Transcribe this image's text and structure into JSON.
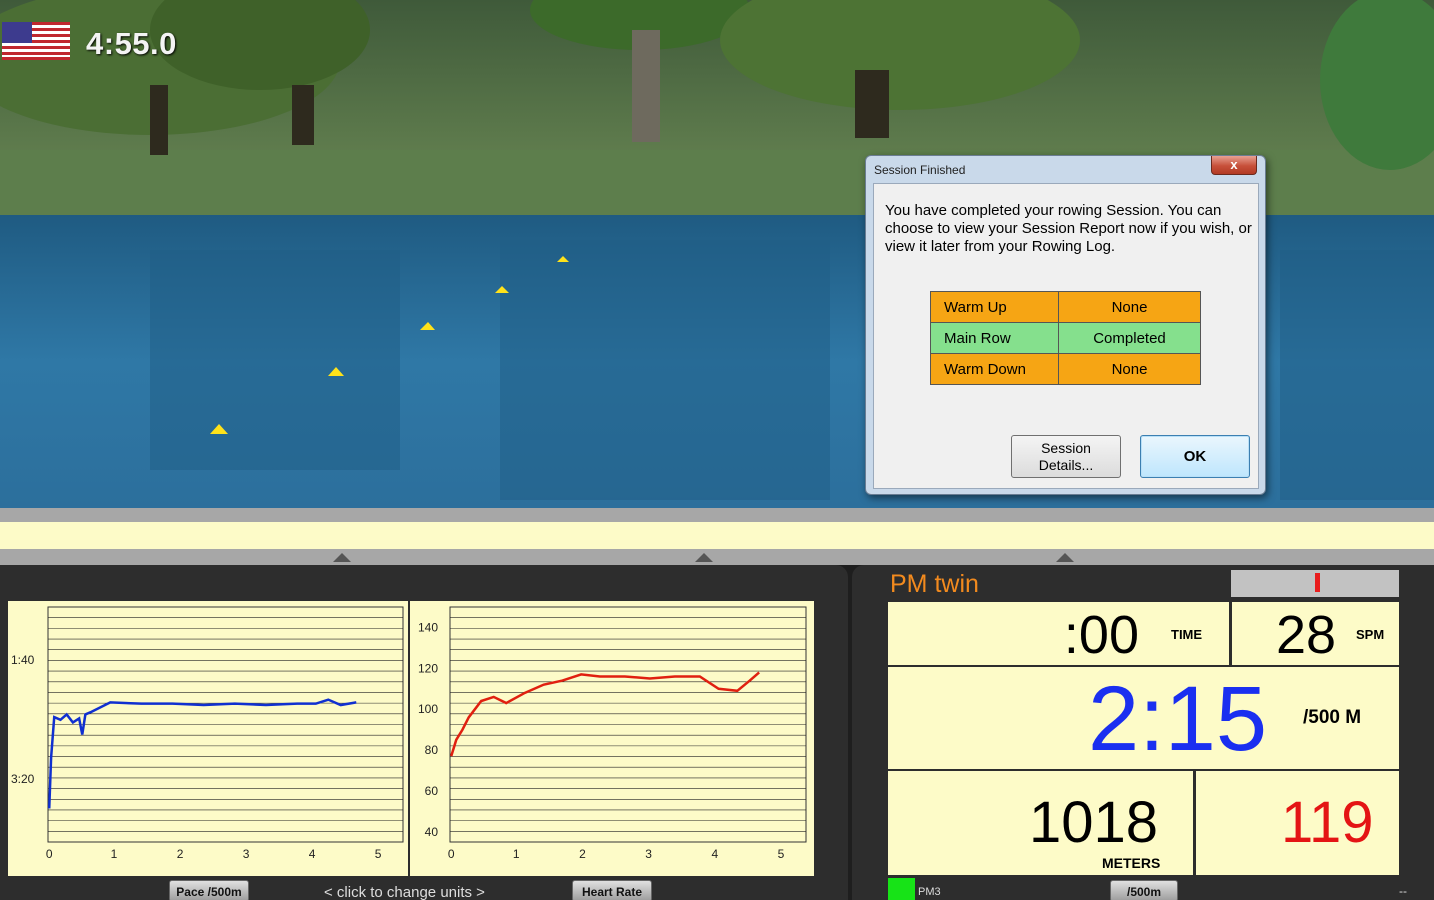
{
  "hud": {
    "elapsed_time": "4:55.0",
    "flag_icon": "us-flag-icon"
  },
  "dialog": {
    "title": "Session Finished",
    "close_glyph": "x",
    "message": "You have completed your rowing Session.  You can choose to view your Session Report now if you wish, or view it later from your Rowing Log.",
    "rows": [
      {
        "label": "Warm Up",
        "value": "None",
        "color": "#f6a514"
      },
      {
        "label": "Main Row",
        "value": "Completed",
        "color": "#85e08d"
      },
      {
        "label": "Warm Down",
        "value": "None",
        "color": "#f6a514"
      }
    ],
    "details_button_line1": "Session",
    "details_button_line2": "Details...",
    "ok_button": "OK"
  },
  "charts": {
    "pace": {
      "y_ticks": [
        "1:40",
        "3:20"
      ],
      "x_ticks": [
        "0",
        "1",
        "2",
        "3",
        "4",
        "5"
      ],
      "button_label": "Pace /500m",
      "line_color": "#1030d0"
    },
    "heart_rate": {
      "y_ticks": [
        "140",
        "120",
        "100",
        "80",
        "60",
        "40"
      ],
      "x_ticks": [
        "0",
        "1",
        "2",
        "3",
        "4",
        "5"
      ],
      "button_label": "Heart Rate",
      "line_color": "#e02010"
    },
    "change_units_text": "<  click to change units  >"
  },
  "chart_data": [
    {
      "type": "line",
      "name": "pace",
      "x": [
        0.02,
        0.05,
        0.1,
        0.2,
        0.3,
        0.4,
        0.5,
        0.55,
        0.6,
        0.7,
        1.0,
        1.5,
        2,
        2.5,
        3,
        3.5,
        4,
        4.3,
        4.5,
        4.7,
        4.95
      ],
      "y": [
        250,
        212,
        182,
        184,
        180,
        186,
        183,
        195,
        180,
        178,
        171,
        172,
        172,
        173,
        172,
        173,
        172,
        172,
        169,
        173,
        171
      ],
      "xlim": [
        0,
        5.7
      ],
      "ylim": [
        100,
        275
      ],
      "y_inverted": true
    },
    {
      "type": "line",
      "name": "heart_rate",
      "x": [
        0.02,
        0.1,
        0.2,
        0.3,
        0.5,
        0.7,
        0.9,
        1.2,
        1.5,
        1.8,
        2.1,
        2.4,
        2.8,
        3.2,
        3.6,
        4.0,
        4.3,
        4.6,
        4.8,
        4.95
      ],
      "y": [
        77,
        85,
        90,
        96,
        104,
        106,
        103,
        108,
        112,
        114,
        117,
        116,
        116,
        115,
        116,
        116,
        110,
        109,
        114,
        118
      ],
      "xlim": [
        0,
        5.7
      ],
      "ylim": [
        35,
        150
      ]
    }
  ],
  "pm": {
    "title": "PM twin",
    "time_value": ":00",
    "time_unit": "TIME",
    "spm_value": "28",
    "spm_unit": "SPM",
    "pace_value": "2:15",
    "pace_unit": "/500 M",
    "meters_value": "1018",
    "meters_unit": "METERS",
    "hr_value": "119",
    "pm_label": "PM3",
    "units_button": "/500m",
    "dash": "--",
    "pace_color": "#1a2ff0",
    "hr_color": "#e41414"
  }
}
